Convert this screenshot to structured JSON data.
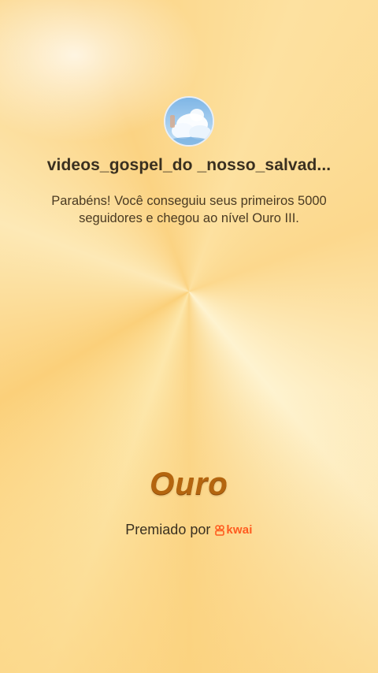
{
  "profile": {
    "username": "videos_gospel_do _nosso_salvad...",
    "avatar_icon": "cloud-avatar-icon"
  },
  "message": "Parabéns! Você conseguiu seus primeiros 5000 seguidores e chegou ao nível Ouro III.",
  "level": {
    "title": "Ouro",
    "color": "#b4650f"
  },
  "award": {
    "label": "Premiado por",
    "brand": "kwai",
    "brand_color": "#ff5b1f"
  },
  "background": {
    "base_color": "#fbd98a"
  }
}
